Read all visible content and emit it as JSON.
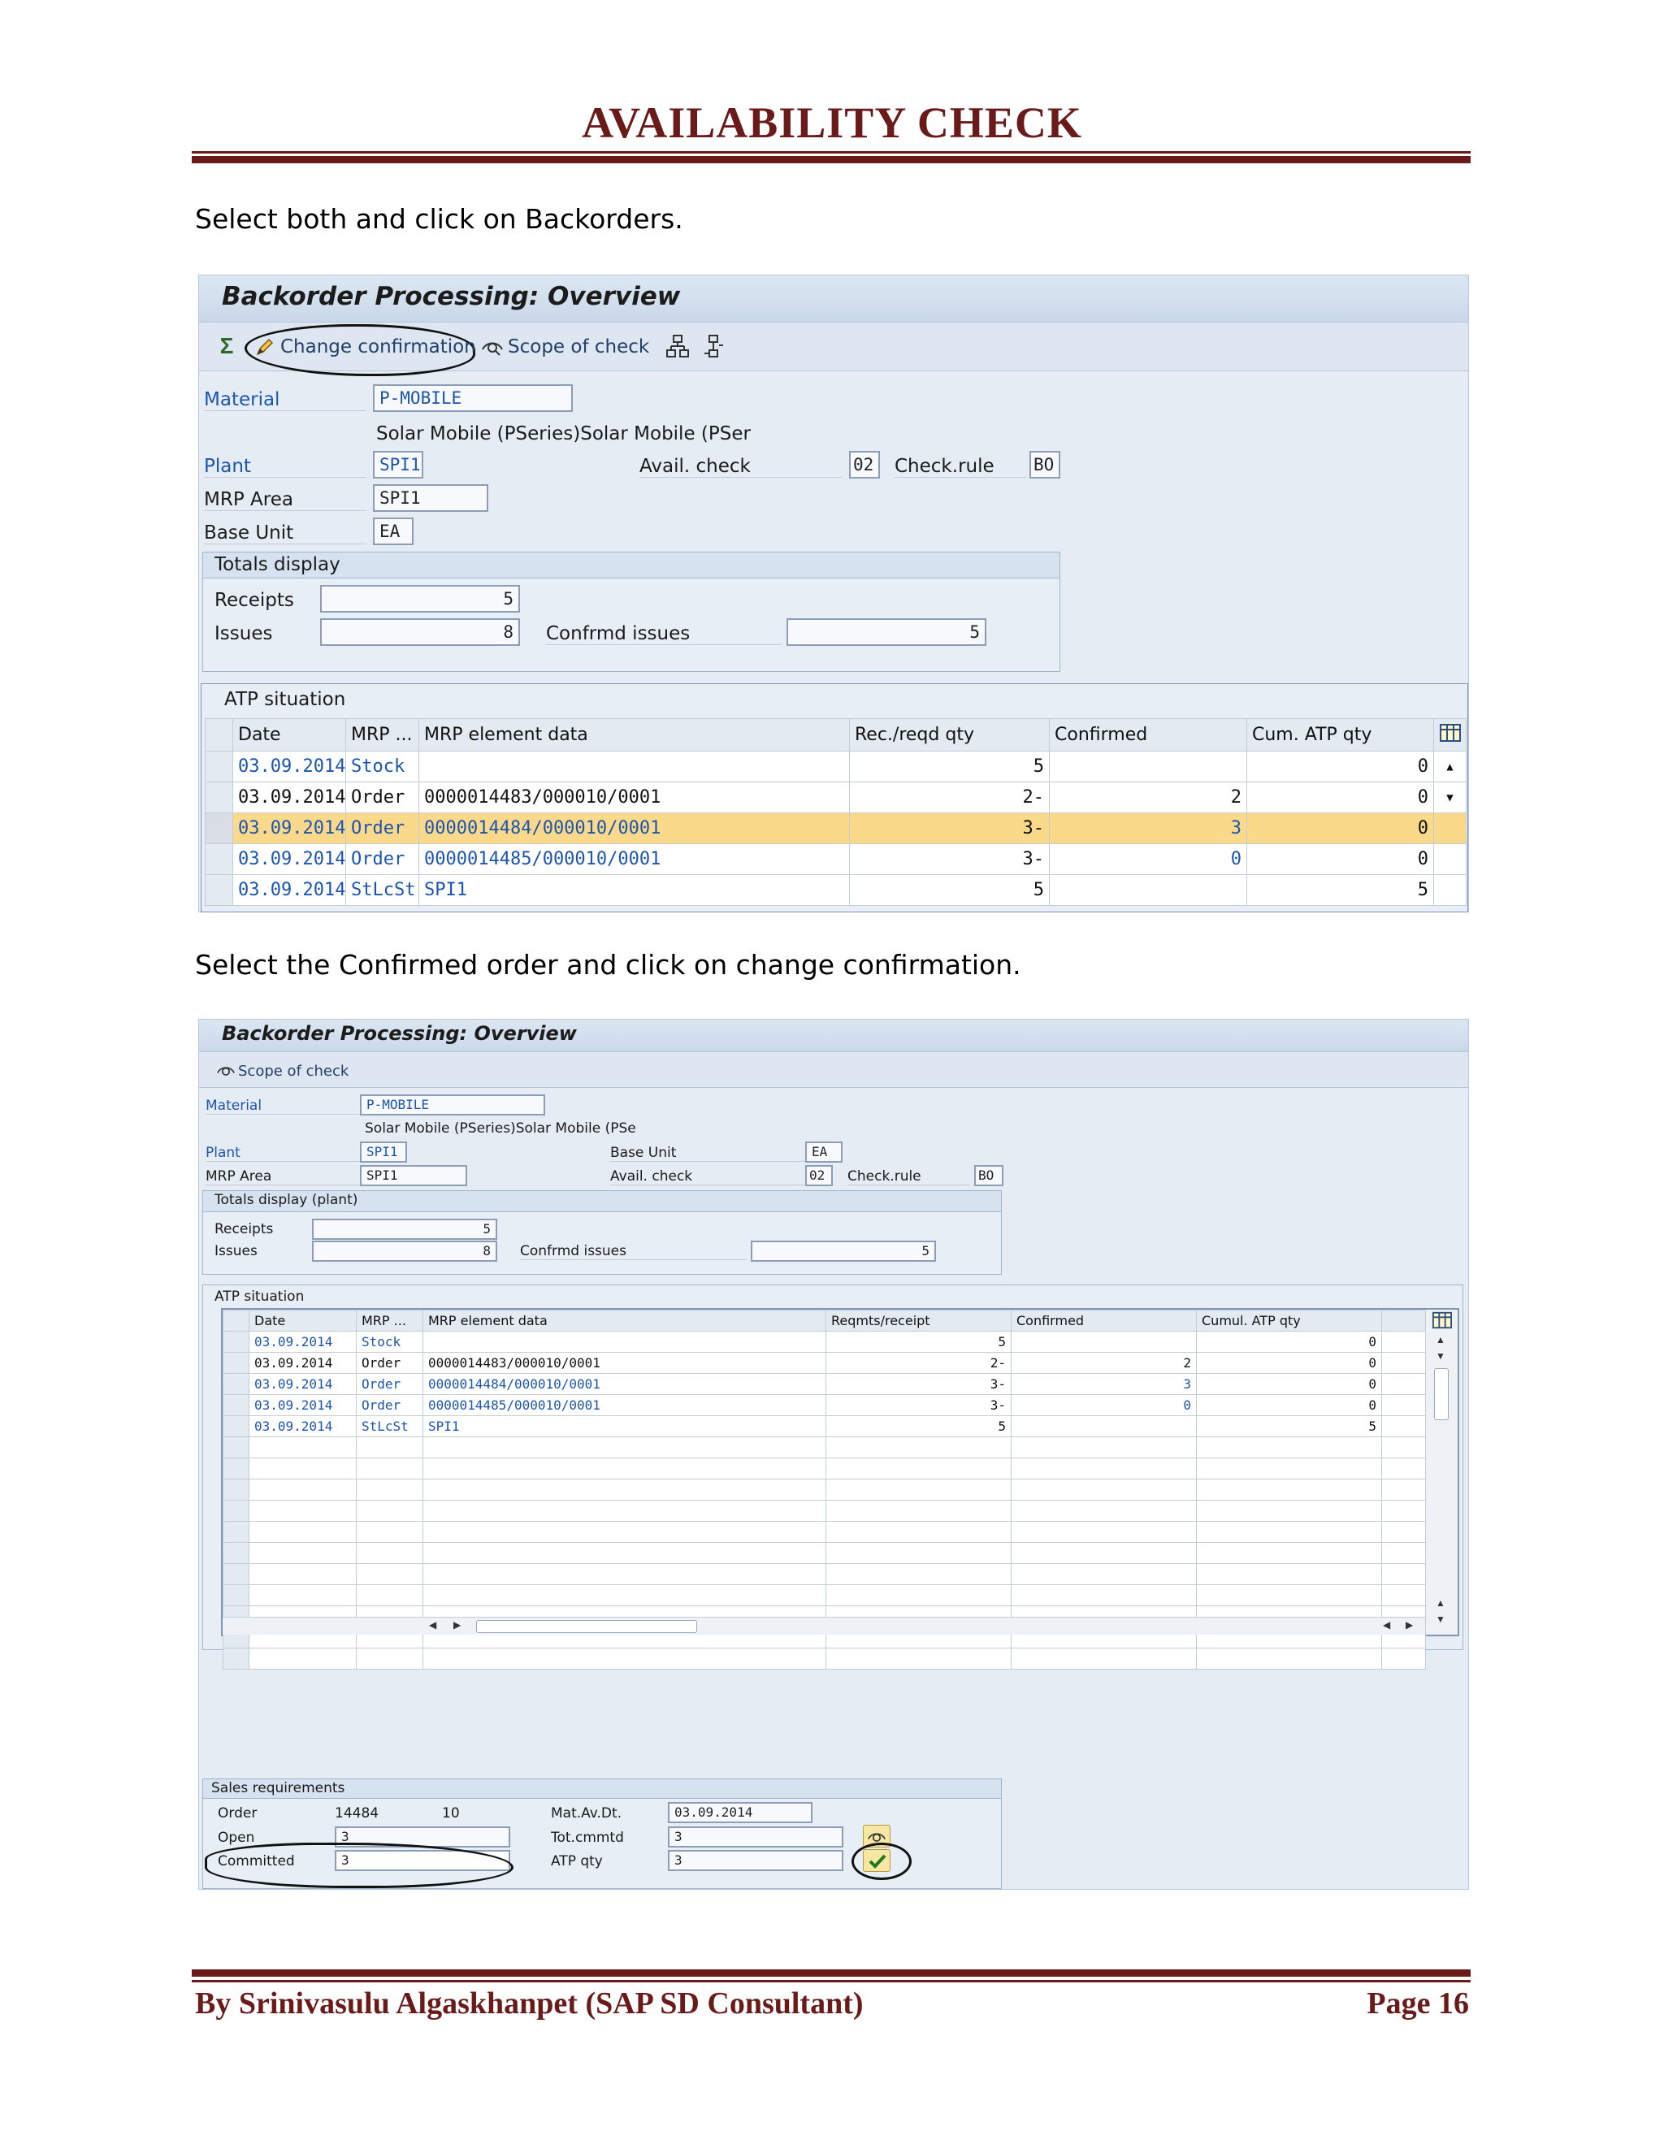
{
  "doc": {
    "title": "AVAILABILITY CHECK",
    "para1": "Select both and click on Backorders.",
    "para2": "Select the Confirmed order and click on change confirmation.",
    "footer_left": "By Srinivasulu Algaskhanpet (SAP SD Consultant)",
    "footer_right": "Page 16"
  },
  "shot1": {
    "title": "Backorder Processing: Overview",
    "toolbar": {
      "change_confirmation": "Change confirmation",
      "scope_of_check": "Scope of check"
    },
    "material_label": "Material",
    "material_value": "P-MOBILE",
    "material_desc": "Solar Mobile (PSeries)Solar Mobile (PSer",
    "plant_label": "Plant",
    "plant_value": "SPI1",
    "avail_check_label": "Avail. check",
    "avail_check_value": "02",
    "check_rule_label": "Check.rule",
    "check_rule_value": "BO",
    "mrp_area_label": "MRP Area",
    "mrp_area_value": "SPI1",
    "base_unit_label": "Base Unit",
    "base_unit_value": "EA",
    "totals": {
      "title": "Totals display",
      "receipts_label": "Receipts",
      "receipts_value": "5",
      "issues_label": "Issues",
      "issues_value": "8",
      "confrmd_label": "Confrmd issues",
      "confrmd_value": "5"
    },
    "atp": {
      "title": "ATP situation",
      "columns": [
        "Date",
        "MRP ...",
        "MRP element data",
        "Rec./reqd qty",
        "Confirmed",
        "Cum. ATP qty"
      ],
      "rows": [
        {
          "date": "03.09.2014",
          "mrp": "Stock",
          "element": "",
          "qty": "5",
          "confirmed": "",
          "cum": "0"
        },
        {
          "date": "03.09.2014",
          "mrp": "Order",
          "element": "0000014483/000010/0001",
          "qty": "2-",
          "confirmed": "2",
          "cum": "0"
        },
        {
          "date": "03.09.2014",
          "mrp": "Order",
          "element": "0000014484/000010/0001",
          "qty": "3-",
          "confirmed": "3",
          "cum": "0"
        },
        {
          "date": "03.09.2014",
          "mrp": "Order",
          "element": "0000014485/000010/0001",
          "qty": "3-",
          "confirmed": "0",
          "cum": "0"
        },
        {
          "date": "03.09.2014",
          "mrp": "StLcSt",
          "element": "SPI1",
          "qty": "5",
          "confirmed": "",
          "cum": "5"
        }
      ]
    }
  },
  "shot2": {
    "title": "Backorder Processing: Overview",
    "toolbar": {
      "scope_of_check": "Scope of check"
    },
    "material_label": "Material",
    "material_value": "P-MOBILE",
    "material_desc": "Solar Mobile (PSeries)Solar Mobile (PSe",
    "plant_label": "Plant",
    "plant_value": "SPI1",
    "base_unit_label": "Base Unit",
    "base_unit_value": "EA",
    "mrp_area_label": "MRP Area",
    "mrp_area_value": "SPI1",
    "avail_check_label": "Avail. check",
    "avail_check_value": "02",
    "check_rule_label": "Check.rule",
    "check_rule_value": "BO",
    "totals": {
      "title": "Totals display (plant)",
      "receipts_label": "Receipts",
      "receipts_value": "5",
      "issues_label": "Issues",
      "issues_value": "8",
      "confrmd_label": "Confrmd issues",
      "confrmd_value": "5"
    },
    "atp": {
      "title": "ATP situation",
      "columns": [
        "Date",
        "MRP ...",
        "MRP element data",
        "Reqmts/receipt",
        "Confirmed",
        "Cumul. ATP qty"
      ],
      "rows": [
        {
          "date": "03.09.2014",
          "mrp": "Stock",
          "element": "",
          "qty": "5",
          "confirmed": "",
          "cum": "0"
        },
        {
          "date": "03.09.2014",
          "mrp": "Order",
          "element": "0000014483/000010/0001",
          "qty": "2-",
          "confirmed": "2",
          "cum": "0"
        },
        {
          "date": "03.09.2014",
          "mrp": "Order",
          "element": "0000014484/000010/0001",
          "qty": "3-",
          "confirmed": "3",
          "cum": "0"
        },
        {
          "date": "03.09.2014",
          "mrp": "Order",
          "element": "0000014485/000010/0001",
          "qty": "3-",
          "confirmed": "0",
          "cum": "0"
        },
        {
          "date": "03.09.2014",
          "mrp": "StLcSt",
          "element": "SPI1",
          "qty": "5",
          "confirmed": "",
          "cum": "5"
        }
      ]
    },
    "sales": {
      "title": "Sales requirements",
      "order_label": "Order",
      "order_value": "14484",
      "item_value": "10",
      "mat_av_dt_label": "Mat.Av.Dt.",
      "mat_av_dt_value": "03.09.2014",
      "open_label": "Open",
      "open_value": "3",
      "tot_cmmtd_label": "Tot.cmmtd",
      "tot_cmmtd_value": "3",
      "committed_label": "Committed",
      "committed_value": "3",
      "atp_qty_label": "ATP qty",
      "atp_qty_value": "3"
    }
  }
}
